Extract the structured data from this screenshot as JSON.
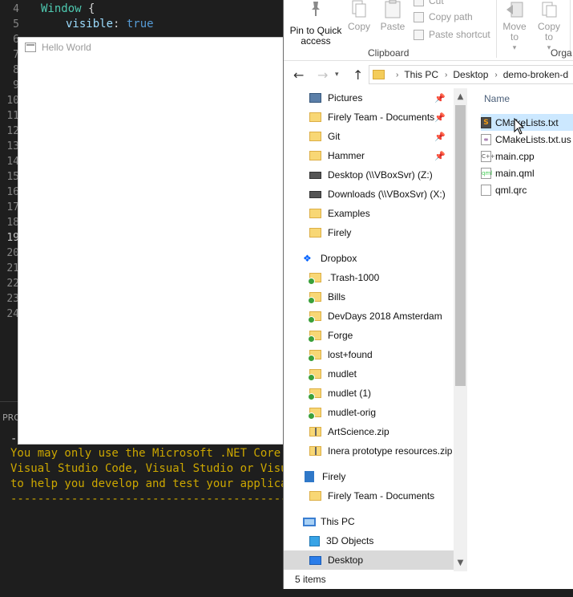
{
  "editor": {
    "line_numbers": [
      "4",
      "5",
      "6",
      "7",
      "8",
      "9",
      "10",
      "11",
      "12",
      "13",
      "14",
      "15",
      "16",
      "17",
      "18",
      "19",
      "20",
      "21",
      "22",
      "23",
      "24"
    ],
    "active_line": "19",
    "code_line_1": {
      "type": "Window",
      "brace": " {"
    },
    "code_line_2": {
      "prop": "visible",
      "colon": ": ",
      "value": "true"
    }
  },
  "hello_world_window": {
    "title": "Hello World"
  },
  "terminal": {
    "tab_label": "PRO",
    "dash": "-",
    "lines": [
      "You may only use the Microsoft .NET Core Deb",
      "Visual Studio Code, Visual Studio or Visual ",
      "to help you develop and test your applicatio",
      "---------------------------------------------"
    ]
  },
  "ribbon": {
    "pin_label": "Pin to Quick access",
    "copy_label": "Copy",
    "paste_label": "Paste",
    "cut_label": "Cut",
    "copy_path_label": "Copy path",
    "paste_shortcut_label": "Paste shortcut",
    "clipboard_group": "Clipboard",
    "move_to_label": "Move to",
    "copy_to_label": "Copy to",
    "organize_group": "Orga"
  },
  "address_bar": {
    "crumbs": [
      "This PC",
      "Desktop",
      "demo-broken-d"
    ]
  },
  "nav_pane": {
    "items": [
      {
        "label": "Pictures",
        "icon": "pictures-icon",
        "pinned": true
      },
      {
        "label": "Firely Team - Documents",
        "icon": "folder-icon",
        "pinned": true
      },
      {
        "label": "Git",
        "icon": "folder-icon",
        "pinned": true
      },
      {
        "label": "Hammer",
        "icon": "folder-icon",
        "pinned": true
      },
      {
        "label": "Desktop (\\\\VBoxSvr) (Z:)",
        "icon": "network-drive-icon",
        "pinned": false
      },
      {
        "label": "Downloads (\\\\VBoxSvr) (X:)",
        "icon": "network-drive-icon",
        "pinned": false
      },
      {
        "label": "Examples",
        "icon": "folder-icon",
        "pinned": false
      },
      {
        "label": "Firely",
        "icon": "folder-icon",
        "pinned": false
      },
      {
        "label": "Dropbox",
        "icon": "dropbox-icon",
        "pinned": false
      },
      {
        "label": ".Trash-1000",
        "icon": "sync-folder-icon",
        "pinned": false
      },
      {
        "label": "Bills",
        "icon": "sync-folder-icon",
        "pinned": false
      },
      {
        "label": "DevDays 2018 Amsterdam",
        "icon": "shared-sync-folder-icon",
        "pinned": false
      },
      {
        "label": "Forge",
        "icon": "shared-sync-folder-icon",
        "pinned": false
      },
      {
        "label": "lost+found",
        "icon": "sync-folder-icon",
        "pinned": false
      },
      {
        "label": "mudlet",
        "icon": "sync-folder-icon",
        "pinned": false
      },
      {
        "label": "mudlet (1)",
        "icon": "shared-sync-folder-icon",
        "pinned": false
      },
      {
        "label": "mudlet-orig",
        "icon": "sync-folder-icon",
        "pinned": false
      },
      {
        "label": "ArtScience.zip",
        "icon": "zip-icon",
        "pinned": false
      },
      {
        "label": "Inera prototype resources.zip",
        "icon": "zip-icon",
        "pinned": false
      },
      {
        "label": "Firely",
        "icon": "building-icon",
        "pinned": false
      },
      {
        "label": "Firely Team - Documents",
        "icon": "folder-icon",
        "pinned": false
      },
      {
        "label": "This PC",
        "icon": "computer-icon",
        "pinned": false
      },
      {
        "label": "3D Objects",
        "icon": "cube-icon",
        "pinned": false
      },
      {
        "label": "Desktop",
        "icon": "desktop-icon",
        "pinned": false,
        "selected": true
      }
    ]
  },
  "file_list": {
    "column_name": "Name",
    "files": [
      {
        "name": "CMakeLists.txt",
        "icon": "sublime-text-icon",
        "selected": true
      },
      {
        "name": "CMakeLists.txt.us",
        "icon": "visual-studio-file-icon",
        "selected": false
      },
      {
        "name": "main.cpp",
        "icon": "cpp-file-icon",
        "selected": false
      },
      {
        "name": "main.qml",
        "icon": "qml-file-icon",
        "selected": false
      },
      {
        "name": "qml.qrc",
        "icon": "text-file-icon",
        "selected": false
      }
    ]
  },
  "status_bar": {
    "item_count": "5 items"
  }
}
